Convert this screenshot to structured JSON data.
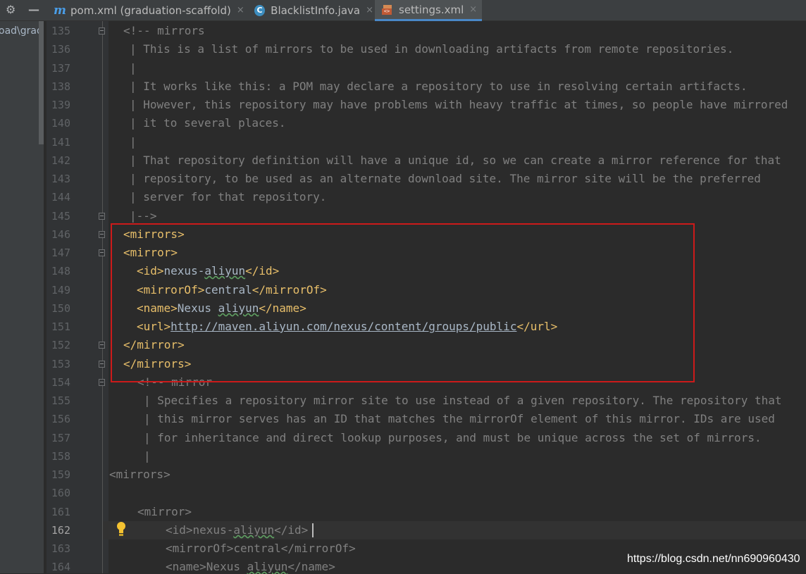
{
  "toolbar": {
    "settings_icon": "gear-icon",
    "minimize_icon": "minus-icon"
  },
  "tabs": [
    {
      "label": "pom.xml (graduation-scaffold)",
      "icon": "maven-m-icon",
      "icon_glyph": "m",
      "close": "×",
      "active": false
    },
    {
      "label": "BlacklistInfo.java",
      "icon": "java-class-icon",
      "icon_glyph": "C",
      "close": "×",
      "active": false
    },
    {
      "label": "settings.xml",
      "icon": "xml-file-icon",
      "icon_glyph": "<>",
      "close": "×",
      "active": true
    }
  ],
  "project_panel": {
    "path_text": "oad\\grad"
  },
  "editor": {
    "current_line": 162,
    "line_numbers": [
      "135",
      "136",
      "137",
      "138",
      "139",
      "140",
      "141",
      "142",
      "143",
      "144",
      "145",
      "146",
      "147",
      "148",
      "149",
      "150",
      "151",
      "152",
      "153",
      "154",
      "155",
      "156",
      "157",
      "158",
      "159",
      "160",
      "161",
      "162",
      "163",
      "164"
    ],
    "lines": {
      "l135": "<!-- mirrors",
      "l136": "| This is a list of mirrors to be used in downloading artifacts from remote repositories.",
      "l137": "|",
      "l138": "| It works like this: a POM may declare a repository to use in resolving certain artifacts.",
      "l139": "| However, this repository may have problems with heavy traffic at times, so people have mirrored",
      "l140": "| it to several places.",
      "l141": "|",
      "l142": "| That repository definition will have a unique id, so we can create a mirror reference for that",
      "l143": "| repository, to be used as an alternate download site. The mirror site will be the preferred",
      "l144": "| server for that repository.",
      "l145": "|-->",
      "l146_open": "<mirrors>",
      "l147_open": "<mirror>",
      "l148_open": "<id>",
      "l148_val": "nexus-",
      "l148_sq": "aliyun",
      "l148_close": "</id>",
      "l149_open": "<mirrorOf>",
      "l149_val": "central",
      "l149_close": "</mirrorOf>",
      "l150_open": "<name>",
      "l150_val": "Nexus ",
      "l150_sq": "aliyun",
      "l150_close": "</name>",
      "l151_open": "<url>",
      "l151_val": "http://maven.aliyun.com/nexus/content/groups/public",
      "l151_close": "</url>",
      "l152": "</mirror>",
      "l153": "</mirrors>",
      "l154": "<!-- mirror",
      "l155": "| Specifies a repository mirror site to use instead of a given repository. The repository that",
      "l156": "| this mirror serves has an ID that matches the mirrorOf element of this mirror. IDs are used",
      "l157": "| for inheritance and direct lookup purposes, and must be unique across the set of mirrors.",
      "l158": "|",
      "l159": "<mirrors>",
      "l161": "<mirror>",
      "l162_open": "<id>",
      "l162_val": "nexus-",
      "l162_sq": "aliyun",
      "l162_close": "</id>",
      "l163_open": "<mirrorOf>",
      "l163_val": "central",
      "l163_close": "</mirrorOf>",
      "l164_open": "<name>",
      "l164_val": "Nexus ",
      "l164_sq": "aliyun",
      "l164_close": "</name>"
    }
  },
  "watermark": "https://blog.csdn.net/nn690960430"
}
